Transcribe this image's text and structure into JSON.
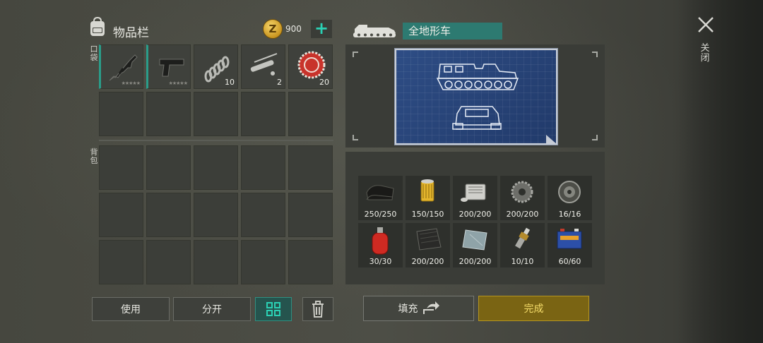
{
  "inventory": {
    "title": "物品栏",
    "coins": "900",
    "add_symbol": "+",
    "pocket_label": "口袋",
    "backpack_label": "背包",
    "pocket_items": [
      {
        "icon": "rifle-icon",
        "count": "",
        "stars": "★★★★★"
      },
      {
        "icon": "pistol-icon",
        "count": "",
        "stars": "★★★★★"
      },
      {
        "icon": "spring-icon",
        "count": "10",
        "stars": ""
      },
      {
        "icon": "pipe-parts-icon",
        "count": "2",
        "stars": ""
      },
      {
        "icon": "bottle-cap-icon",
        "count": "20",
        "stars": ""
      }
    ]
  },
  "actions": {
    "use": "使用",
    "split": "分开"
  },
  "vehicle": {
    "name": "全地形车"
  },
  "materials": [
    {
      "icon": "rubber-sheet-icon",
      "count": "250/250"
    },
    {
      "icon": "oil-filter-icon",
      "count": "150/150"
    },
    {
      "icon": "engine-block-icon",
      "count": "200/200"
    },
    {
      "icon": "gear-icon",
      "count": "200/200"
    },
    {
      "icon": "wheel-icon",
      "count": "16/16"
    },
    {
      "icon": "fire-extinguisher-icon",
      "count": "30/30"
    },
    {
      "icon": "carbon-fiber-icon",
      "count": "200/200"
    },
    {
      "icon": "metal-plate-icon",
      "count": "200/200"
    },
    {
      "icon": "spark-plug-icon",
      "count": "10/10"
    },
    {
      "icon": "battery-icon",
      "count": "60/60"
    }
  ],
  "craft": {
    "fill": "填充",
    "done": "完成"
  },
  "close_label": "关闭",
  "colors": {
    "accent_teal": "#2d7a71",
    "done_gold": "#7a6413",
    "coin_gold": "#c9951f"
  }
}
